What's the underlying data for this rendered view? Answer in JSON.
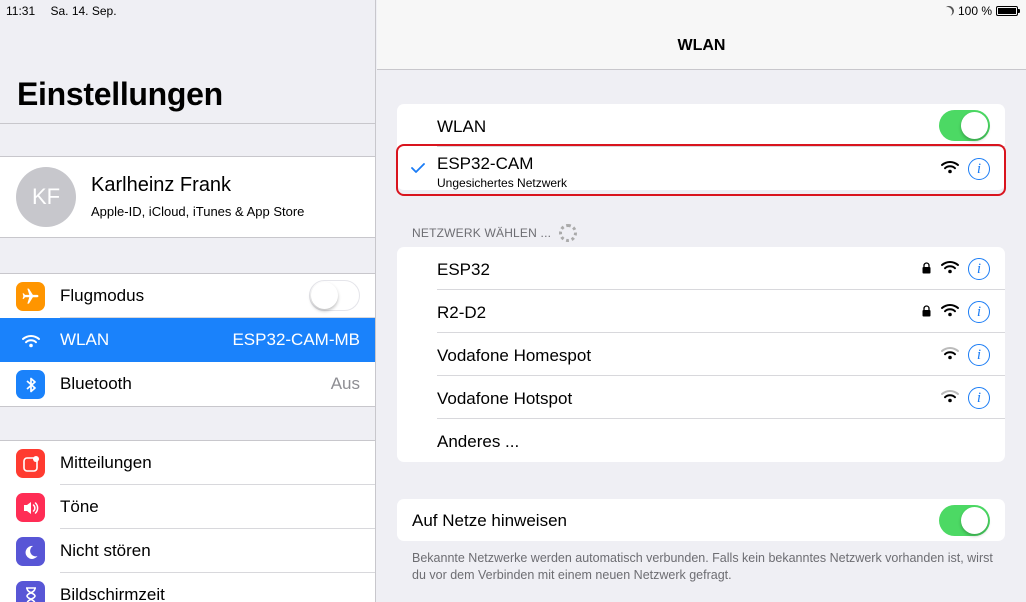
{
  "status_bar": {
    "time": "11:31",
    "date": "Sa. 14. Sep.",
    "battery": "100 %"
  },
  "sidebar": {
    "title": "Einstellungen",
    "profile": {
      "initials": "KF",
      "name": "Karlheinz Frank",
      "subtitle": "Apple-ID, iCloud, iTunes & App Store"
    },
    "group1": [
      {
        "label": "Flugmodus",
        "icon": "airplane-icon",
        "color": "#ff9500",
        "toggle": "off"
      },
      {
        "label": "WLAN",
        "icon": "wifi-icon",
        "color": "#1a82fb",
        "value": "ESP32-CAM-MB",
        "selected": true
      },
      {
        "label": "Bluetooth",
        "icon": "bluetooth-icon",
        "color": "#1a82fb",
        "value": "Aus"
      }
    ],
    "group2": [
      {
        "label": "Mitteilungen",
        "icon": "notifications-icon",
        "color": "#ff3b30"
      },
      {
        "label": "Töne",
        "icon": "sound-icon",
        "color": "#ff2d55"
      },
      {
        "label": "Nicht stören",
        "icon": "moon-icon",
        "color": "#5856d6"
      },
      {
        "label": "Bildschirmzeit",
        "icon": "hourglass-icon",
        "color": "#5856d6"
      }
    ]
  },
  "detail": {
    "nav_title": "WLAN",
    "wlan_label": "WLAN",
    "wlan_on": true,
    "connected": {
      "name": "ESP32-CAM",
      "subtitle": "Ungesichertes Netzwerk"
    },
    "choose_header": "NETZWERK WÄHLEN ...",
    "networks": [
      {
        "name": "ESP32",
        "locked": true
      },
      {
        "name": "R2-D2",
        "locked": true
      },
      {
        "name": "Vodafone Homespot",
        "locked": false
      },
      {
        "name": "Vodafone Hotspot",
        "locked": false
      }
    ],
    "other_label": "Anderes ...",
    "notify_label": "Auf Netze hinweisen",
    "notify_on": true,
    "footer": "Bekannte Netzwerke werden automatisch verbunden. Falls kein bekanntes Netzwerk vorhanden ist, wirst du vor dem Verbinden mit einem neuen Netzwerk gefragt."
  },
  "colors": {
    "accent": "#1a82fb",
    "toggle_on": "#4cd964",
    "highlight": "#d9141e"
  }
}
